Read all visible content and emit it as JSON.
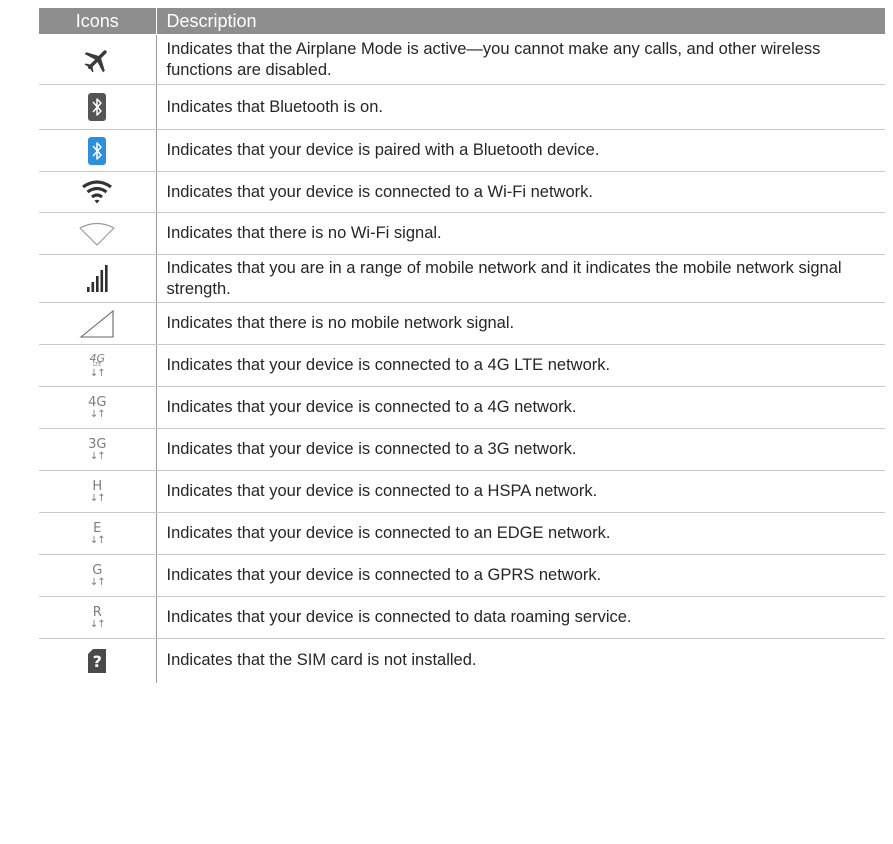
{
  "table": {
    "header": {
      "icons": "Icons",
      "description": "Description"
    },
    "rows": [
      {
        "icon": "airplane-icon",
        "text": "Indicates that the Airplane Mode is active—you cannot make any calls, and other wireless functions are disabled."
      },
      {
        "icon": "bluetooth-on-icon",
        "text": "Indicates that Bluetooth is  on."
      },
      {
        "icon": "bluetooth-paired-icon",
        "text": "Indicates that your device is paired with a Bluetooth  device."
      },
      {
        "icon": "wifi-connected-icon",
        "text": "Indicates that your device is connected to a Wi-Fi  network."
      },
      {
        "icon": "wifi-no-signal-icon",
        "text": "Indicates that there is no Wi-Fi signal."
      },
      {
        "icon": "mobile-signal-icon",
        "text": "Indicates that you are in a range of mobile network and it indicates the mobile network signal  strength."
      },
      {
        "icon": "no-mobile-signal-icon",
        "text": "Indicates that there is no mobile network  signal."
      },
      {
        "icon": "4g-lte-icon",
        "label": "4G",
        "sublabel": "LTE",
        "arrows": "↓↑",
        "text": "Indicates that your device is connected to a 4G LTE  network."
      },
      {
        "icon": "4g-icon",
        "label": "4G",
        "arrows": "↓↑",
        "text": "Indicates that your device is connected to a 4G  network."
      },
      {
        "icon": "3g-icon",
        "label": "3G",
        "arrows": "↓↑",
        "text": "Indicates that your device is connected to a 3G  network."
      },
      {
        "icon": "hspa-icon",
        "label": "H",
        "arrows": "↓↑",
        "text": "Indicates that your device is connected to a HSPA  network."
      },
      {
        "icon": "edge-icon",
        "label": "E",
        "arrows": "↓↑",
        "text": "Indicates that your device is connected to an EDGE  network."
      },
      {
        "icon": "gprs-icon",
        "label": "G",
        "arrows": "↓↑",
        "text": "Indicates that your device is connected to a GPRS  network."
      },
      {
        "icon": "roaming-icon",
        "label": "R",
        "arrows": "↓↑",
        "text": "Indicates that your device is connected to data roaming  service."
      },
      {
        "icon": "no-sim-icon",
        "label": "?",
        "text": "Indicates that the SIM card is not  installed."
      }
    ]
  },
  "colors": {
    "header_bg": "#8e8e8e",
    "bluetooth_paired": "#2f8fd8",
    "bluetooth_on": "#555555"
  }
}
